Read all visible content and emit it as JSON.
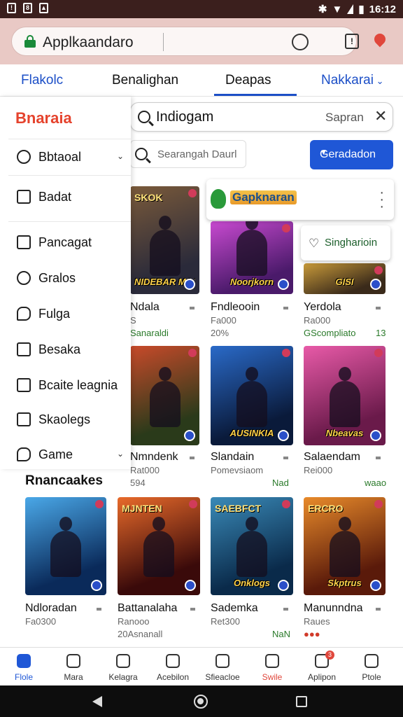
{
  "status_bar": {
    "time": "16:12",
    "icons": [
      "sim-icon",
      "settings-icon",
      "image-icon",
      "bluetooth-icon",
      "wifi-icon",
      "signal-icon",
      "battery-icon"
    ]
  },
  "browser": {
    "url": "Applkaandaro"
  },
  "top_tabs": [
    {
      "label": "Flakolc",
      "color": "#1c4fc7"
    },
    {
      "label": "Benalighan",
      "color": "#111111"
    },
    {
      "label": "Deapas",
      "color": "#111111",
      "active": true
    },
    {
      "label": "Nakkarai",
      "color": "#1c4fc7"
    }
  ],
  "search": {
    "query": "Indiogam",
    "action": "Sapran",
    "placeholder": "Searangah Daurl"
  },
  "cta": {
    "label": "Geradadon"
  },
  "drawer": {
    "title": "Bnaraia",
    "items": [
      {
        "label": "Bbtaoal",
        "icon": "radio-icon"
      },
      {
        "label": "Badat",
        "icon": "list-icon"
      },
      {
        "label": "Pancagat",
        "icon": "list-icon"
      },
      {
        "label": "Gralos",
        "icon": "search-icon"
      },
      {
        "label": "Fulga",
        "icon": "chat-icon"
      },
      {
        "label": "Besaka",
        "icon": "message-icon"
      },
      {
        "label": "Bcaite leagnia",
        "icon": "calendar-icon"
      },
      {
        "label": "Skaolegs",
        "icon": "stack-icon"
      },
      {
        "label": "Game",
        "icon": "chat-bubble-icon"
      }
    ]
  },
  "floating_card_1": {
    "name": "Gapknaran"
  },
  "floating_card_2": {
    "label": "Singharioin"
  },
  "section_title": "Rnancaakes",
  "games_grid": [
    {
      "title": "Ndala",
      "sub": "S",
      "meta": "Sanaraldi",
      "art_text": "NIDEBAR MAJAINS",
      "top_text": "SKOK",
      "c1": "#2a2a3a",
      "c2": "#7a5a3a"
    },
    {
      "title": "Fndleooin",
      "sub": "Fa000",
      "meta": "20%",
      "art_text": "Noorjkorn",
      "top_text": "",
      "c1": "#4a1a6a",
      "c2": "#c84ad0"
    },
    {
      "title": "Yerdola",
      "sub": "Ra000",
      "meta": "GScompliato",
      "extra": "13",
      "art_text": "GISI",
      "top_text": "",
      "c1": "#3a2a1a",
      "c2": "#c89a3a"
    },
    {
      "title": "Nmndenk",
      "sub": "Rat000",
      "meta": "594",
      "art_text": "",
      "top_text": "",
      "c1": "#2a3a1a",
      "c2": "#c84a2a"
    },
    {
      "title": "Slandain",
      "sub": "Pomevsiaom",
      "meta": "Nad",
      "art_text": "AUSINKIA",
      "top_text": "",
      "c1": "#0a1a3a",
      "c2": "#2a6ac8"
    },
    {
      "title": "Salaendam",
      "sub": "Rei000",
      "meta": "waao",
      "art_text": "Nbeavas",
      "top_text": "",
      "c1": "#6a1a4a",
      "c2": "#e85aa8"
    },
    {
      "title": "Ndloradan",
      "sub": "Fa0300",
      "meta": "",
      "art_text": "",
      "top_text": "",
      "c1": "#0a2a5a",
      "c2": "#4aa8e8"
    },
    {
      "title": "Battanalaha",
      "sub": "Ranooo",
      "meta": "20Asnanall",
      "art_text": "",
      "top_text": "MJNTEN",
      "c1": "#3a0a0a",
      "c2": "#e86a2a"
    },
    {
      "title": "Sademka",
      "sub": "Ret300",
      "meta": "NaN",
      "art_text": "Onklogs",
      "top_text": "SAEBFCT",
      "c1": "#0a2a4a",
      "c2": "#3a8ab8"
    },
    {
      "title": "Manunndna",
      "sub": "Raues",
      "meta": "●●●",
      "art_text": "Skptrus",
      "top_text": "ERCRO",
      "c1": "#5a1a0a",
      "c2": "#e88a2a"
    }
  ],
  "bottom_nav": [
    {
      "label": "Flole",
      "icon": "home-icon",
      "state": "active"
    },
    {
      "label": "Mara",
      "icon": "tree-icon",
      "state": ""
    },
    {
      "label": "Kelagra",
      "icon": "compass-icon",
      "state": ""
    },
    {
      "label": "Acebilon",
      "icon": "people-icon",
      "state": ""
    },
    {
      "label": "Sfieacloe",
      "icon": "calendar-icon",
      "state": ""
    },
    {
      "label": "Swile",
      "icon": "chat-icon",
      "state": "red"
    },
    {
      "label": "Aplipon",
      "icon": "notification-icon",
      "state": "",
      "badge": "3"
    },
    {
      "label": "Ptole",
      "icon": "profile-icon",
      "state": ""
    }
  ]
}
